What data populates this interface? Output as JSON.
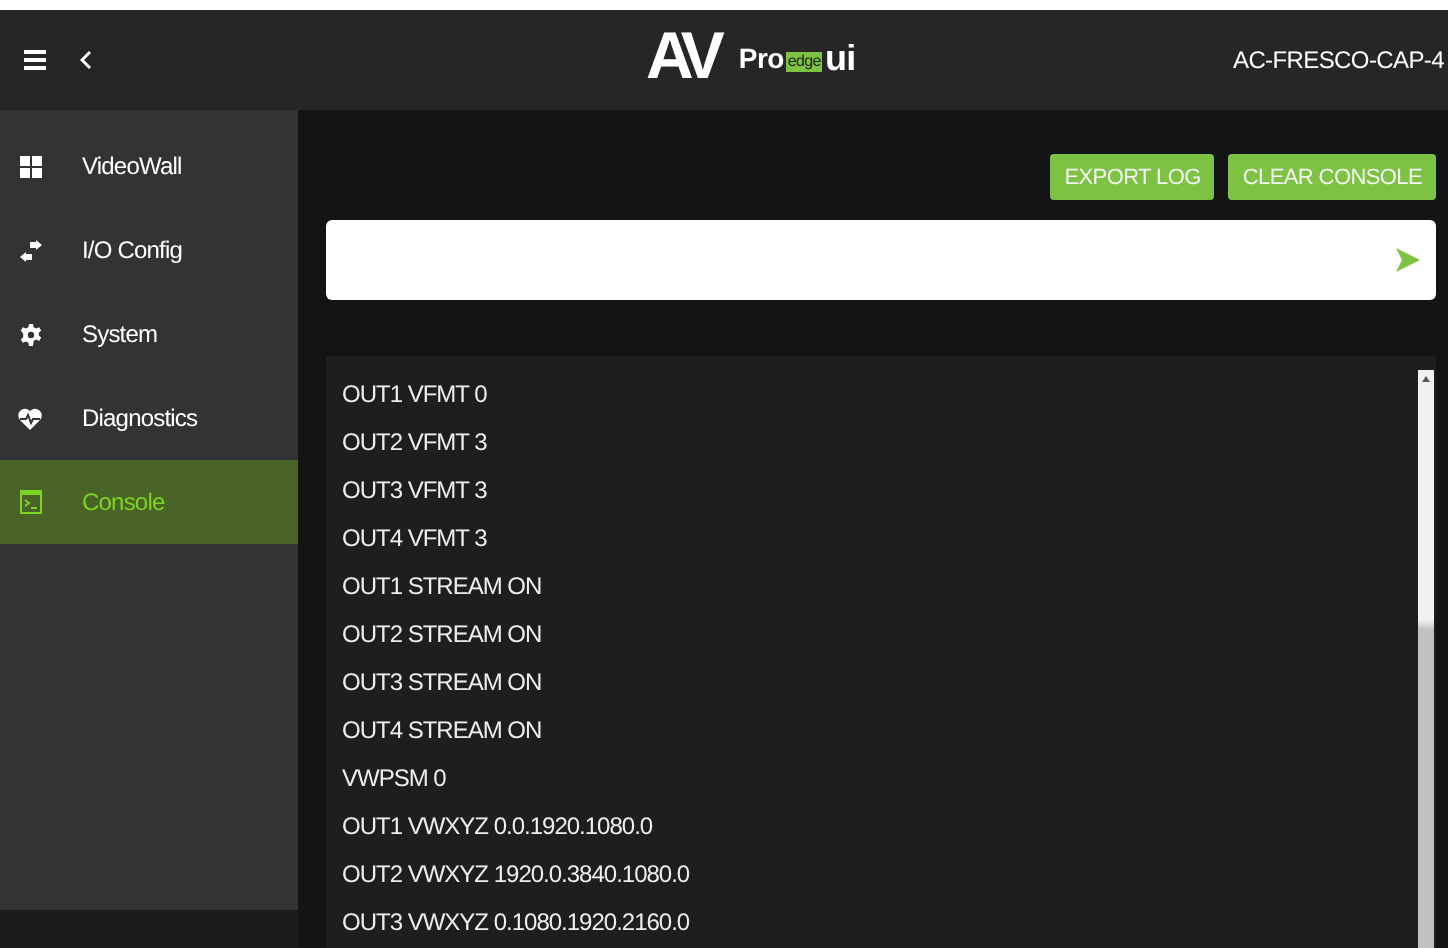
{
  "header": {
    "logo": {
      "mark": "AV",
      "name": "Pro",
      "badge": "edge",
      "suffix": "ui"
    },
    "device": "AC-FRESCO-CAP-4"
  },
  "sidebar": {
    "items": [
      {
        "label": "VideoWall",
        "selected": false
      },
      {
        "label": "I/O Config",
        "selected": false
      },
      {
        "label": "System",
        "selected": false
      },
      {
        "label": "Diagnostics",
        "selected": false
      },
      {
        "label": "Console",
        "selected": true
      }
    ]
  },
  "toolbar": {
    "buttons": [
      "EXPORT LOG",
      "CLEAR CONSOLE"
    ]
  },
  "console": {
    "lines": [
      "OUT1 VFMT 0",
      "OUT2 VFMT 3",
      "OUT3 VFMT 3",
      "OUT4 VFMT 3",
      "OUT1 STREAM ON",
      "OUT2 STREAM ON",
      "OUT3 STREAM ON",
      "OUT4 STREAM ON",
      "VWPSM 0",
      "OUT1 VWXYZ 0.0.1920.1080.0",
      "OUT2 VWXYZ 1920.0.3840.1080.0",
      "OUT3 VWXYZ 0.1080.1920.2160.0"
    ]
  }
}
